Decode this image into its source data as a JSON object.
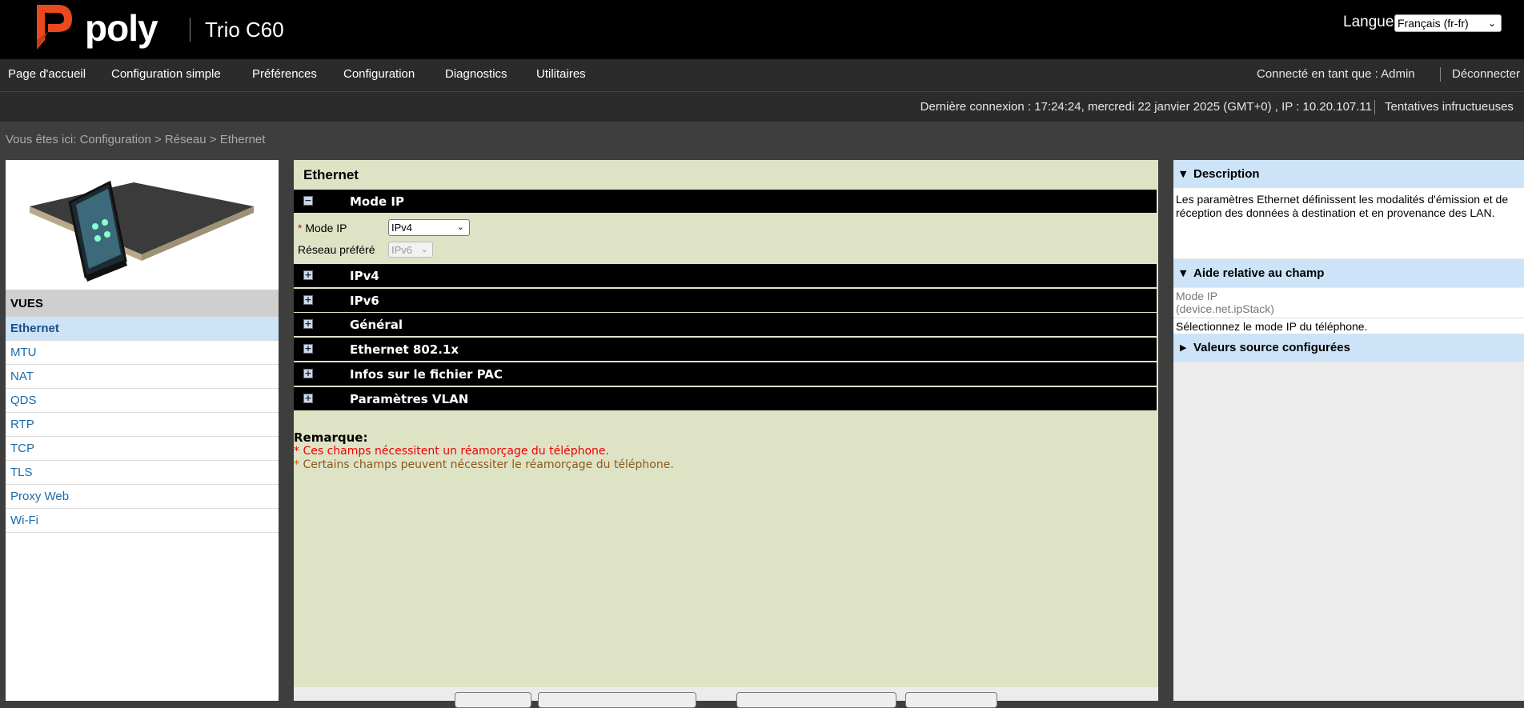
{
  "header": {
    "brand": "poly",
    "model": "Trio C60",
    "language_label": "Langue",
    "language_value": "Français (fr-fr)"
  },
  "nav": {
    "items": [
      "Page d'accueil",
      "Configuration simple",
      "Préférences",
      "Configuration",
      "Diagnostics",
      "Utilitaires"
    ],
    "user": "Connecté en tant que : Admin",
    "logout": "Déconnecter"
  },
  "status": {
    "last_login": "Dernière connexion : 17:24:24, mercredi 22 janvier 2025 (GMT+0) , IP : 10.20.107.11",
    "failed_attempts": "Tentatives infructueuses"
  },
  "breadcrumb": {
    "prefix": "Vous êtes ici:",
    "path": [
      "Configuration",
      "Réseau",
      "Ethernet"
    ],
    "separator": ">"
  },
  "views": {
    "title": "VUES",
    "items": [
      "Ethernet",
      "MTU",
      "NAT",
      "QDS",
      "RTP",
      "TCP",
      "TLS",
      "Proxy Web",
      "Wi-Fi"
    ],
    "active": "Ethernet"
  },
  "main": {
    "title": "Ethernet",
    "sections": [
      {
        "label": "Mode IP",
        "expanded": true
      },
      {
        "label": "IPv4",
        "expanded": false
      },
      {
        "label": "IPv6",
        "expanded": false
      },
      {
        "label": "Général",
        "expanded": false
      },
      {
        "label": "Ethernet 802.1x",
        "expanded": false
      },
      {
        "label": "Infos sur le fichier PAC",
        "expanded": false
      },
      {
        "label": "Paramètres VLAN",
        "expanded": false
      }
    ],
    "toggle_expanded": "−",
    "toggle_collapsed": "+",
    "fields": {
      "mode_ip": {
        "label": "Mode IP",
        "value": "IPv4",
        "required_mark": "*"
      },
      "preferred_network": {
        "label": "Réseau préféré",
        "value": "IPv6"
      }
    },
    "remarks": {
      "title": "Remarque:",
      "reboot_required": "* Ces champs nécessitent un réamorçage du téléphone.",
      "reboot_may_required": "Certains champs peuvent nécessiter le réamorçage du téléphone.",
      "reboot_may_mark": "*"
    }
  },
  "right_panel": {
    "description": {
      "title": "Description",
      "text": "Les paramètres Ethernet définissent les modalités d'émission et de réception des données à destination et en provenance des LAN."
    },
    "field_help": {
      "title": "Aide relative au champ",
      "field_name": "Mode IP",
      "field_param": "(device.net.ipStack)",
      "help_text": "Sélectionnez le mode IP du téléphone."
    },
    "configured_sources": {
      "title": "Valeurs source configurées"
    }
  },
  "colors": {
    "header_bg": "#000000",
    "nav_bg": "#2b2b2b",
    "brand_red": "#e8491d",
    "content_bg": "#dfe3c6",
    "panel_head": "#cde3f7",
    "link": "#1a6bab",
    "required": "#e00000"
  }
}
